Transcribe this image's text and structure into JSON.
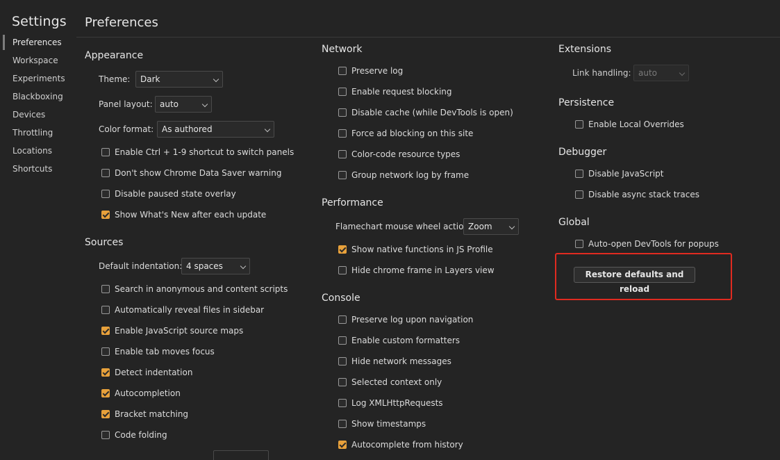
{
  "sidebar": {
    "title": "Settings",
    "items": [
      {
        "label": "Preferences"
      },
      {
        "label": "Workspace"
      },
      {
        "label": "Experiments"
      },
      {
        "label": "Blackboxing"
      },
      {
        "label": "Devices"
      },
      {
        "label": "Throttling"
      },
      {
        "label": "Locations"
      },
      {
        "label": "Shortcuts"
      }
    ]
  },
  "main": {
    "title": "Preferences",
    "appearance": {
      "title": "Appearance",
      "theme_label": "Theme:",
      "theme_value": "Dark",
      "panel_layout_label": "Panel layout:",
      "panel_layout_value": "auto",
      "color_format_label": "Color format:",
      "color_format_value": "As authored",
      "options": [
        {
          "label": "Enable Ctrl + 1-9 shortcut to switch panels",
          "checked": false
        },
        {
          "label": "Don't show Chrome Data Saver warning",
          "checked": false
        },
        {
          "label": "Disable paused state overlay",
          "checked": false
        },
        {
          "label": "Show What's New after each update",
          "checked": true
        }
      ]
    },
    "sources": {
      "title": "Sources",
      "indent_label": "Default indentation:",
      "indent_value": "4 spaces",
      "options": [
        {
          "label": "Search in anonymous and content scripts",
          "checked": false
        },
        {
          "label": "Automatically reveal files in sidebar",
          "checked": false
        },
        {
          "label": "Enable JavaScript source maps",
          "checked": true
        },
        {
          "label": "Enable tab moves focus",
          "checked": false
        },
        {
          "label": "Detect indentation",
          "checked": true
        },
        {
          "label": "Autocompletion",
          "checked": true
        },
        {
          "label": "Bracket matching",
          "checked": true
        },
        {
          "label": "Code folding",
          "checked": false
        }
      ]
    },
    "network": {
      "title": "Network",
      "options": [
        {
          "label": "Preserve log",
          "checked": false
        },
        {
          "label": "Enable request blocking",
          "checked": false
        },
        {
          "label": "Disable cache (while DevTools is open)",
          "checked": false
        },
        {
          "label": "Force ad blocking on this site",
          "checked": false
        },
        {
          "label": "Color-code resource types",
          "checked": false
        },
        {
          "label": "Group network log by frame",
          "checked": false
        }
      ]
    },
    "performance": {
      "title": "Performance",
      "flame_label": "Flamechart mouse wheel action:",
      "flame_value": "Zoom",
      "options": [
        {
          "label": "Show native functions in JS Profile",
          "checked": true
        },
        {
          "label": "Hide chrome frame in Layers view",
          "checked": false
        }
      ]
    },
    "console": {
      "title": "Console",
      "options": [
        {
          "label": "Preserve log upon navigation",
          "checked": false
        },
        {
          "label": "Enable custom formatters",
          "checked": false
        },
        {
          "label": "Hide network messages",
          "checked": false
        },
        {
          "label": "Selected context only",
          "checked": false
        },
        {
          "label": "Log XMLHttpRequests",
          "checked": false
        },
        {
          "label": "Show timestamps",
          "checked": false
        },
        {
          "label": "Autocomplete from history",
          "checked": true
        }
      ]
    },
    "extensions": {
      "title": "Extensions",
      "link_label": "Link handling:",
      "link_value": "auto"
    },
    "persistence": {
      "title": "Persistence",
      "options": [
        {
          "label": "Enable Local Overrides",
          "checked": false
        }
      ]
    },
    "debugger": {
      "title": "Debugger",
      "options": [
        {
          "label": "Disable JavaScript",
          "checked": false
        },
        {
          "label": "Disable async stack traces",
          "checked": false
        }
      ]
    },
    "global": {
      "title": "Global",
      "options": [
        {
          "label": "Auto-open DevTools for popups",
          "checked": false
        }
      ],
      "restore_label": "Restore defaults and reload"
    }
  },
  "colors": {
    "accent": "#e8a13b",
    "highlight": "#e02b20",
    "background": "#242424"
  }
}
